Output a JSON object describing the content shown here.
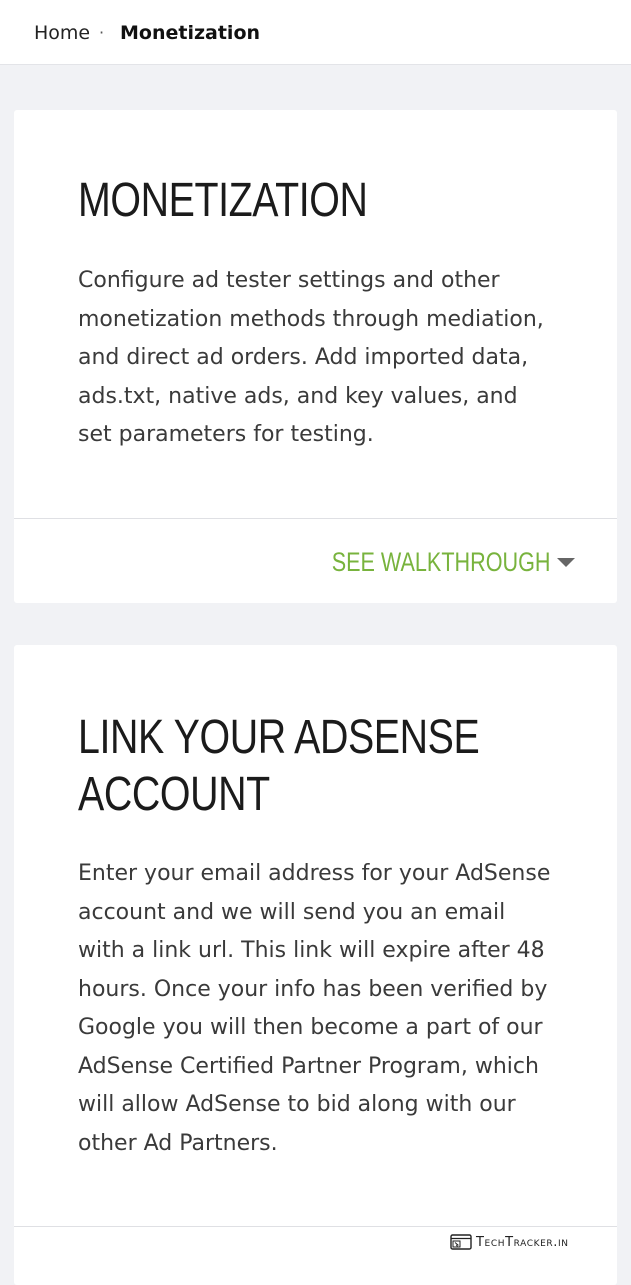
{
  "breadcrumb": {
    "home": "Home",
    "separator": "·",
    "current": "Monetization"
  },
  "card_monetization": {
    "title": "MONETIZATION",
    "body": "Configure ad tester settings and other monetization methods through mediation, and direct ad orders. Add imported data, ads.txt, native ads, and key values, and set parameters for testing.",
    "walkthrough_label": "SEE WALKTHROUGH",
    "walkthrough_icon": "caret-down-icon"
  },
  "card_adsense": {
    "title": "LINK YOUR ADSENSE ACCOUNT",
    "body": "Enter your email address for your AdSense account and we will send you an email with a link url. This link will expire after 48 hours. Once your info has been verified by Google you will then become a part of our AdSense Certified Partner Program, which will allow AdSense to bid along with our other Ad Partners."
  },
  "watermark": {
    "text": "TechTracker.in",
    "icon": "browser-window-icon"
  },
  "colors": {
    "accent_green": "#78b33d",
    "page_background": "#f1f2f5",
    "card_background": "#ffffff"
  }
}
